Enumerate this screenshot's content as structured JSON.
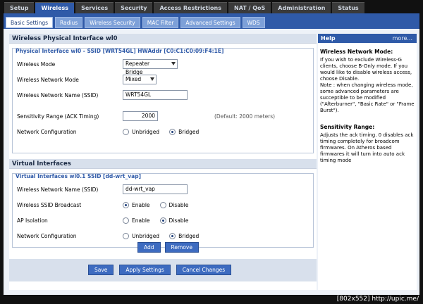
{
  "top_tabs": [
    "Setup",
    "Wireless",
    "Services",
    "Security",
    "Access Restrictions",
    "NAT / QoS",
    "Administration",
    "Status"
  ],
  "active_top_tab": "Wireless",
  "sub_tabs": [
    "Basic Settings",
    "Radius",
    "Wireless Security",
    "MAC Filter",
    "Advanced Settings",
    "WDS"
  ],
  "active_sub_tab": "Basic Settings",
  "physical": {
    "section_title": "Wireless Physical Interface wl0",
    "legend": "Physical Interface wl0 - SSID [WRT54GL] HWAddr [C0:C1:C0:09:F4:1E]",
    "wireless_mode_label": "Wireless Mode",
    "wireless_mode_value": "Repeater Bridge",
    "network_mode_label": "Wireless Network Mode",
    "network_mode_value": "Mixed",
    "ssid_label": "Wireless Network Name (SSID)",
    "ssid_value": "WRT54GL",
    "sensitivity_label": "Sensitivity Range (ACK Timing)",
    "sensitivity_value": "2000",
    "sensitivity_default": "(Default: 2000 meters)",
    "netconf_label": "Network Configuration",
    "unbridged": "Unbridged",
    "bridged": "Bridged"
  },
  "virtual": {
    "section_title": "Virtual Interfaces",
    "legend": "Virtual Interfaces wl0.1 SSID [dd-wrt_vap]",
    "ssid_label": "Wireless Network Name (SSID)",
    "ssid_value": "dd-wrt_vap",
    "broadcast_label": "Wireless SSID Broadcast",
    "enable": "Enable",
    "disable": "Disable",
    "ap_isolation_label": "AP Isolation",
    "netconf_label": "Network Configuration",
    "unbridged": "Unbridged",
    "bridged": "Bridged",
    "add": "Add",
    "remove": "Remove"
  },
  "footer": {
    "save": "Save",
    "apply": "Apply Settings",
    "cancel": "Cancel Changes"
  },
  "help": {
    "title": "Help",
    "more": "more...",
    "h1": "Wireless Network Mode:",
    "p1": "If you wish to exclude Wireless-G clients, choose B-Only mode. If you would like to disable wireless access, choose Disable.",
    "p1b": "Note : when changing wireless mode, some advanced parameters are succeptible to be modified (\"Afterburner\", \"Basic Rate\" or \"Frame Burst\").",
    "h2": "Sensitivity Range:",
    "p2": "Adjusts the ack timing. 0 disables ack timing completely for broadcom firmwares. On Atheros based firmwares it will turn into auto ack timing mode"
  },
  "watermark": "[802x552] http://upic.me/"
}
